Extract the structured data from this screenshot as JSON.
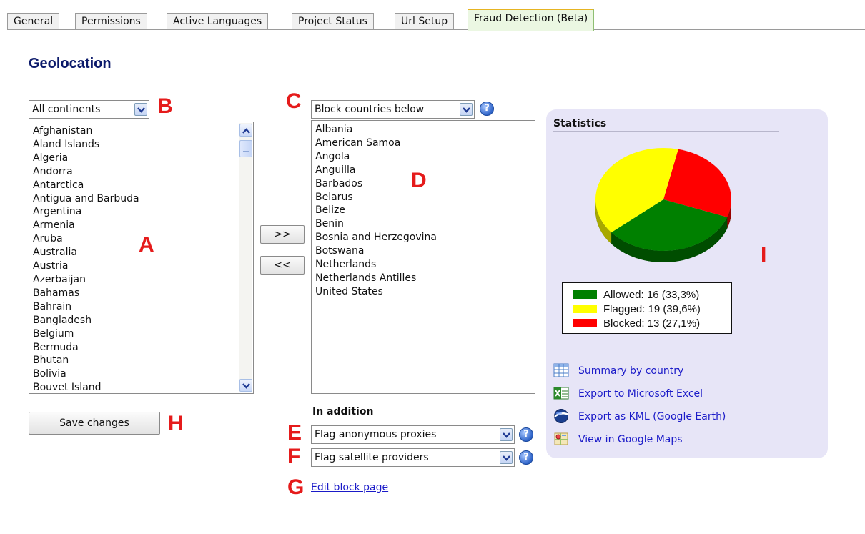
{
  "tabs": [
    {
      "label": "General",
      "active": false
    },
    {
      "label": "Permissions",
      "active": false
    },
    {
      "label": "Active Languages",
      "active": false
    },
    {
      "label": "Project Status",
      "active": false
    },
    {
      "label": "Url Setup",
      "active": false
    },
    {
      "label": "Fraud Detection (Beta)",
      "active": true
    }
  ],
  "page_title": "Geolocation",
  "markers": {
    "A": "A",
    "B": "B",
    "C": "C",
    "D": "D",
    "E": "E",
    "F": "F",
    "G": "G",
    "H": "H",
    "I": "I"
  },
  "continent_select": {
    "value": "All continents"
  },
  "available_countries": [
    "Afghanistan",
    "Aland Islands",
    "Algeria",
    "Andorra",
    "Antarctica",
    "Antigua and Barbuda",
    "Argentina",
    "Armenia",
    "Aruba",
    "Australia",
    "Austria",
    "Azerbaijan",
    "Bahamas",
    "Bahrain",
    "Bangladesh",
    "Belgium",
    "Bermuda",
    "Bhutan",
    "Bolivia",
    "Bouvet Island"
  ],
  "mode_select": {
    "value": "Block countries below"
  },
  "selected_countries": [
    "Albania",
    "American Samoa",
    "Angola",
    "Anguilla",
    "Barbados",
    "Belarus",
    "Belize",
    "Benin",
    "Bosnia and Herzegovina",
    "Botswana",
    "Netherlands",
    "Netherlands Antilles",
    "United States"
  ],
  "move_buttons": {
    "add": ">>",
    "remove": "<<"
  },
  "save_button": "Save changes",
  "in_addition": {
    "heading": "In addition",
    "proxies_select": "Flag anonymous proxies",
    "satellite_select": "Flag satellite providers",
    "edit_link": "Edit block page"
  },
  "statistics": {
    "title": "Statistics",
    "legend": [
      {
        "label": "Allowed: 16 (33,3%)",
        "color": "#008000",
        "value": 16
      },
      {
        "label": "Flagged: 19 (39,6%)",
        "color": "#ffff00",
        "value": 19
      },
      {
        "label": "Blocked: 13 (27,1%)",
        "color": "#ff0000",
        "value": 13
      }
    ],
    "links": [
      {
        "label": "Summary by country",
        "icon": "table-icon"
      },
      {
        "label": "Export to Microsoft Excel",
        "icon": "excel-icon"
      },
      {
        "label": "Export as KML (Google Earth)",
        "icon": "google-earth-icon"
      },
      {
        "label": "View in Google Maps",
        "icon": "google-maps-icon"
      }
    ]
  },
  "colors": {
    "title": "#0c1a6b",
    "marker": "#e51b1b",
    "link": "#1a1ac8",
    "panel": "#e7e5f7",
    "active_tab": "#ebf7e2"
  }
}
